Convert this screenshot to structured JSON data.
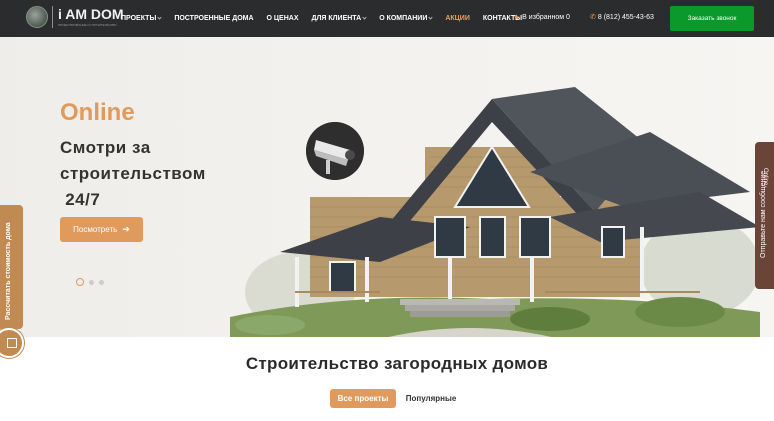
{
  "header": {
    "logo_text": "i AM DOM",
    "logo_sub": "ПРОЕКТИРОВАНИЕ И СТРОИТЕЛЬСТВО",
    "nav": [
      {
        "label": "Проекты",
        "has_dropdown": true
      },
      {
        "label": "Построенные дома",
        "has_dropdown": false
      },
      {
        "label": "О ценах",
        "has_dropdown": false
      },
      {
        "label": "Для клиента",
        "has_dropdown": true
      },
      {
        "label": "О компании",
        "has_dropdown": true
      },
      {
        "label": "Акции",
        "has_dropdown": false,
        "active": true
      },
      {
        "label": "Контакты",
        "has_dropdown": false
      }
    ],
    "favorites": "В избранном 0",
    "phone": "8 (812) 455-43-63",
    "callback_button": "Заказать звонок"
  },
  "hero": {
    "online": "Online",
    "title_lines": [
      "Смотри  за",
      "строительством",
      " 24/7"
    ],
    "button": "Посмотреть",
    "slides_total": 3,
    "active_slide": 1
  },
  "side": {
    "calc_tab": "Рассчитать стоимость дома",
    "message_tab": "Отправьте нам сообщение",
    "online_label": "Online"
  },
  "section": {
    "title": "Строительство загородных домов",
    "filters": [
      "Все проекты",
      "Популярные"
    ],
    "active_filter": "Все проекты"
  },
  "colors": {
    "header_bg": "#2b2c2e",
    "accent": "#e09a5c",
    "callback_green": "#0a9a2b",
    "side_brown": "#c08a52",
    "message_brown": "#6b4438"
  },
  "icons": [
    "logo-mark-icon",
    "star-icon",
    "phone-icon",
    "arrow-right-icon",
    "calculator-icon",
    "camera-icon"
  ]
}
